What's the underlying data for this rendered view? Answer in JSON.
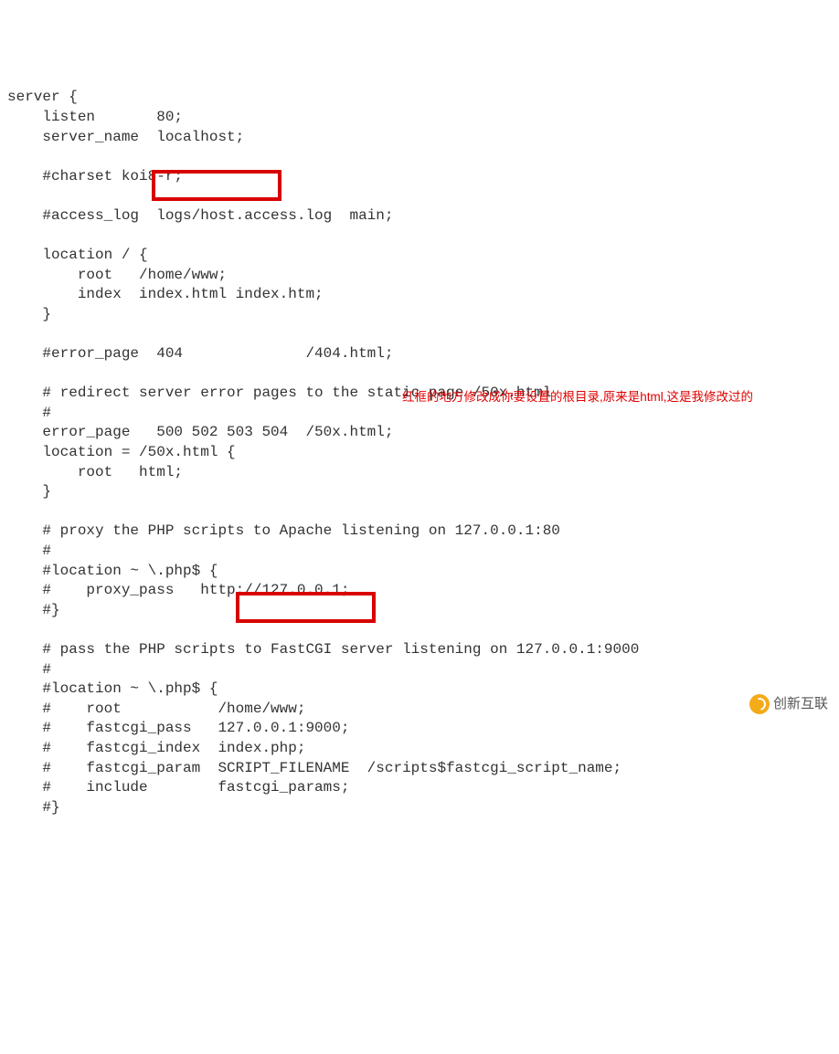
{
  "lines": [
    "server {",
    "    listen       80;",
    "    server_name  localhost;",
    "",
    "    #charset koi8-r;",
    "",
    "    #access_log  logs/host.access.log  main;",
    "",
    "    location / {",
    "        root   /home/www;",
    "        index  index.html index.htm;",
    "    }",
    "",
    "    #error_page  404              /404.html;",
    "",
    "    # redirect server error pages to the static page /50x.html",
    "    #",
    "    error_page   500 502 503 504  /50x.html;",
    "    location = /50x.html {",
    "        root   html;",
    "    }",
    "",
    "    # proxy the PHP scripts to Apache listening on 127.0.0.1:80",
    "    #",
    "    #location ~ \\.php$ {",
    "    #    proxy_pass   http://127.0.0.1;",
    "    #}",
    "",
    "    # pass the PHP scripts to FastCGI server listening on 127.0.0.1:9000",
    "    #",
    "    #location ~ \\.php$ {",
    "    #    root           /home/www;",
    "    #    fastcgi_pass   127.0.0.1:9000;",
    "    #    fastcgi_index  index.php;",
    "    #    fastcgi_param  SCRIPT_FILENAME  /scripts$fastcgi_script_name;",
    "    #    include        fastcgi_params;",
    "    #}"
  ],
  "annotation_text": "红框的地方修改成你要设置的根目录,原来是html,这是我修改过的",
  "watermark_text": "创新互联"
}
